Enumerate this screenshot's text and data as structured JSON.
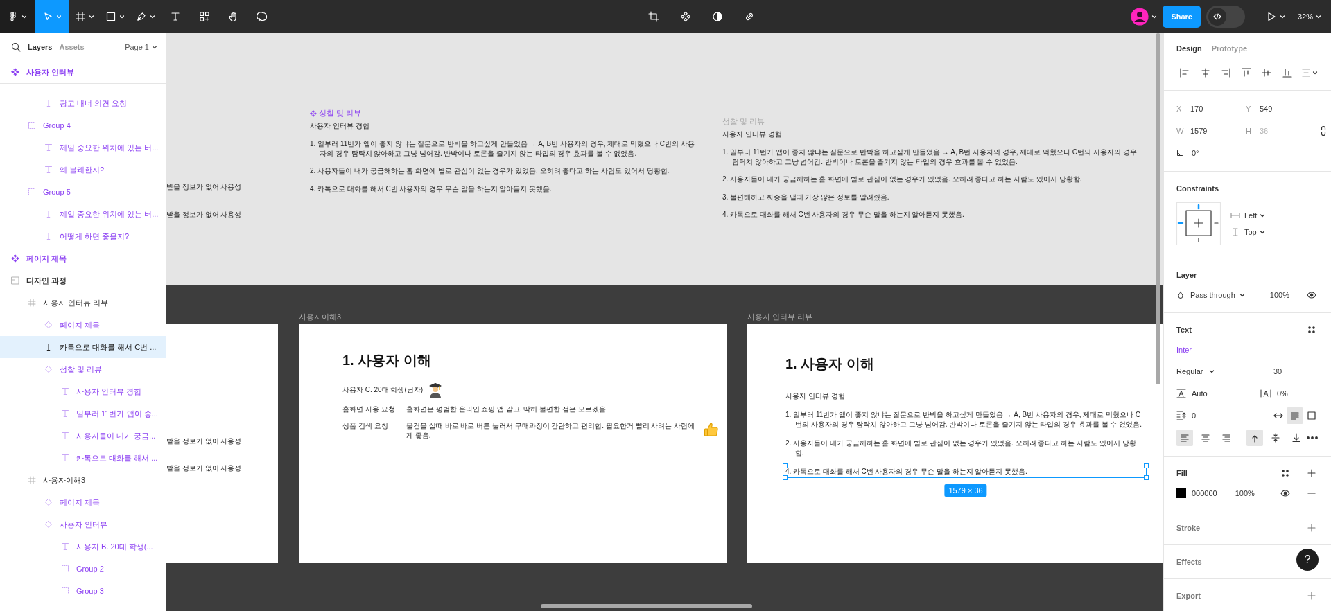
{
  "toolbar": {
    "tools": [
      {
        "kind": "logo",
        "selected": false,
        "menu": true
      },
      {
        "kind": "move",
        "selected": true,
        "menu": true
      },
      {
        "kind": "frame",
        "selected": false,
        "menu": true
      },
      {
        "kind": "rectangle",
        "selected": false,
        "menu": true
      },
      {
        "kind": "pen",
        "selected": false,
        "menu": true
      },
      {
        "kind": "text",
        "selected": false,
        "menu": false
      },
      {
        "kind": "resources",
        "selected": false,
        "menu": false
      },
      {
        "kind": "hand",
        "selected": false,
        "menu": false
      },
      {
        "kind": "comment",
        "selected": false,
        "menu": false
      }
    ],
    "center_tools": [
      {
        "kind": "crop"
      },
      {
        "kind": "component"
      },
      {
        "kind": "contrast"
      },
      {
        "kind": "link"
      }
    ],
    "share": "Share",
    "dev_mode": false,
    "zoom": "32%"
  },
  "layers_panel": {
    "tabs": [
      {
        "label": "Layers",
        "selected": true
      },
      {
        "label": "Assets",
        "selected": false
      }
    ],
    "page": "Page 1",
    "tree": [
      {
        "kind": "component",
        "label": "사용자 인터뷰",
        "pinned": true,
        "selected": false,
        "children": [
          {
            "children": [
              {
                "kind": "text",
                "label": "광고 배너 의견 요청",
                "selected": false
              }
            ]
          },
          {
            "kind": "group",
            "label": "Group 4",
            "selected": false,
            "children": [
              {
                "kind": "text",
                "label": "제일 중요한 위치에 있는 버...",
                "selected": false
              },
              {
                "kind": "text",
                "label": "왜 불쾌한지?",
                "selected": false
              }
            ]
          },
          {
            "kind": "group",
            "label": "Group 5",
            "selected": false,
            "children": [
              {
                "kind": "text",
                "label": "제일 중요한 위치에 있는 버...",
                "selected": false
              },
              {
                "kind": "text",
                "label": "어떻게 하면 좋을지?",
                "selected": false
              }
            ]
          }
        ]
      },
      {
        "kind": "component",
        "label": "페이지 제목",
        "selected": false
      },
      {
        "kind": "section",
        "label": "디자인 과정",
        "selected": false,
        "children": [
          {
            "kind": "frame",
            "label": "사용자 인터뷰 리뷰",
            "selected": false,
            "children": [
              {
                "kind": "instance",
                "label": "페이지 제목",
                "selected": false
              },
              {
                "kind": "text",
                "label": "카톡으로 대화를 해서 C번 ...",
                "selected": true
              },
              {
                "kind": "instance",
                "label": "성찰 및 리뷰",
                "selected": false,
                "children": [
                  {
                    "kind": "text",
                    "label": "사용자 인터뷰 경험",
                    "selected": false
                  },
                  {
                    "kind": "text",
                    "label": "일부러 11번가 앱이 좋...",
                    "selected": false
                  },
                  {
                    "kind": "text",
                    "label": "사용자들이 내가 궁금...",
                    "selected": false
                  },
                  {
                    "kind": "text",
                    "label": "카톡으로 대화를 해서 ...",
                    "selected": false
                  }
                ]
              }
            ]
          },
          {
            "kind": "frame",
            "label": "사용자이해3",
            "selected": false,
            "children": [
              {
                "kind": "instance",
                "label": "페이지 제목",
                "selected": false
              },
              {
                "kind": "instance",
                "label": "사용자 인터뷰",
                "selected": false,
                "children": [
                  {
                    "kind": "text",
                    "label": "사용자 B. 20대 학생(...",
                    "selected": false
                  },
                  {
                    "kind": "group",
                    "label": "Group 2",
                    "selected": false
                  },
                  {
                    "kind": "group",
                    "label": "Group 3",
                    "selected": false
                  }
                ]
              }
            ]
          }
        ]
      }
    ]
  },
  "canvas": {
    "upper_fragments": [
      "받을 정보가 없어 사용성",
      "받을 정보가 없어 사용성"
    ],
    "groups": [
      {
        "kind": "component",
        "title": "성찰 및 리뷰",
        "subtitle": "사용자 인터뷰 경험",
        "items": [
          "1. 일부러 11번가 앱이 좋지 않냐는 질문으로 반박을 하고싶게 만들었음 → A, B번 사용자의 경우, 제대로 먹혔으나 C번의 사용자의 경우 탐탁치 않아하고 그냥 넘어감. 반박이나 토론을 즐기지 않는 타입의 경우 효과를 볼 수 없었음.",
          "2. 사용자들이 내가 궁금해하는 홈 화면에 별로 관심이 없는 경우가 있었음. 오히려 좋다고 하는 사람도 있어서 당황함.",
          "4. 카톡으로 대화를 해서 C번 사용자의 경우 무슨 말을 하는지 알아듣지 못했음."
        ]
      },
      {
        "kind": "plain",
        "title": "성찰 및 리뷰",
        "subtitle": "사용자 인터뷰 경험",
        "items": [
          "1. 일부러 11번가 앱이 좋지 않냐는 질문으로 반박을 하고싶게 만들었음 → A, B번 사용자의 경우, 제대로 먹혔으나 C번의 사용자의 경우 탐탁치 않아하고 그냥 넘어감. 반박이나 토론을 즐기지 않는 타입의 경우 효과를 볼 수 없었음.",
          "2. 사용자들이 내가 궁금해하는 홈 화면에 별로 관심이 없는 경우가 있었음. 오히려 좋다고 하는 사람도 있어서 당황함.",
          "3. 불편해하고 짜증을 낼때 가장 많은 정보를 알려줬음.",
          "4. 카톡으로 대화를 해서 C번 사용자의 경우 무슨 말을 하는지 알아듣지 못했음."
        ]
      }
    ],
    "frames": [
      {
        "kind": "fragment",
        "fragments": [
          "받을 정보가 없어 사용성",
          "받을 정보가 없어 사용성"
        ]
      },
      {
        "kind": "persona",
        "label": "사용자이해3",
        "heading": "1. 사용자 이해",
        "persona": "사용자 C. 20대 학생(남자)",
        "rows": [
          {
            "kind": "plain",
            "label": "홈화면 사용 요청",
            "text": "홈화면은 평범한 온라인 쇼핑 앱 같고, 딱히 불편한 점은 모르겠음"
          },
          {
            "kind": "thumbs-up",
            "label": "상품 검색 요청",
            "text": "물건을 살때 바로 바로 버튼 눌러서 구매과정이 간단하고 편리함. 필요한거 빨리 사려는 사람에게 좋음."
          }
        ]
      },
      {
        "kind": "review",
        "label": "사용자 인터뷰 리뷰",
        "heading": "1. 사용자 이해",
        "subtitle": "사용자 인터뷰 경험",
        "items": [
          {
            "text": "1. 일부러 11번가 앱이 좋지 않냐는 질문으로 반박을 하고싶게 만들었음 → A, B번 사용자의 경우, 제대로 먹혔으나 C번의 사용자의 경우 탐탁치 않아하고 그냥 넘어감. 반박이나 토론을 즐기지 않는 타입의 경우 효과를 볼 수 없었음.",
            "selected": false
          },
          {
            "text": "2. 사용자들이 내가 궁금해하는 홈 화면에 별로 관심이 없는 경우가 있었음. 오히려 좋다고 하는 사람도 있어서 당황함.",
            "selected": false
          },
          {
            "text": "4. 카톡으로 대화를 해서 C번 사용자의 경우 무슨 말을 하는지 알아듣지 못했음.",
            "selected": true
          }
        ],
        "selection_size": "1579 × 36"
      }
    ]
  },
  "design_panel": {
    "tabs": [
      {
        "label": "Design",
        "selected": true
      },
      {
        "label": "Prototype",
        "selected": false
      }
    ],
    "position": [
      {
        "axis": "X",
        "value": "170",
        "disabled": false
      },
      {
        "axis": "Y",
        "value": "549",
        "disabled": false
      },
      {
        "axis": "W",
        "value": "1579",
        "disabled": false
      },
      {
        "axis": "H",
        "value": "36",
        "disabled": true
      }
    ],
    "rotation": "0°",
    "constraints": {
      "title": "Constraints",
      "horizontal": "Left",
      "vertical": "Top"
    },
    "layer": {
      "title": "Layer",
      "blend": "Pass through",
      "opacity": "100%"
    },
    "text": {
      "title": "Text",
      "font": "Inter",
      "style": "Regular",
      "size": "30",
      "line_height": "Auto",
      "letter_spacing": "0%",
      "paragraph_spacing": "0",
      "resizing": [
        {
          "kind": "auto-width",
          "selected": false
        },
        {
          "kind": "auto-height",
          "selected": true
        },
        {
          "kind": "fixed",
          "selected": false
        }
      ],
      "h_align": [
        {
          "kind": "left",
          "selected": true
        },
        {
          "kind": "center",
          "selected": false
        },
        {
          "kind": "right",
          "selected": false
        }
      ],
      "v_align": [
        {
          "kind": "top",
          "selected": true
        },
        {
          "kind": "middle",
          "selected": false
        },
        {
          "kind": "bottom",
          "selected": false
        }
      ]
    },
    "fill": {
      "title": "Fill",
      "color": "#000000",
      "hex": "000000",
      "opacity": "100%"
    },
    "collapsed_sections": [
      "Stroke",
      "Effects",
      "Export"
    ],
    "help": "?"
  }
}
